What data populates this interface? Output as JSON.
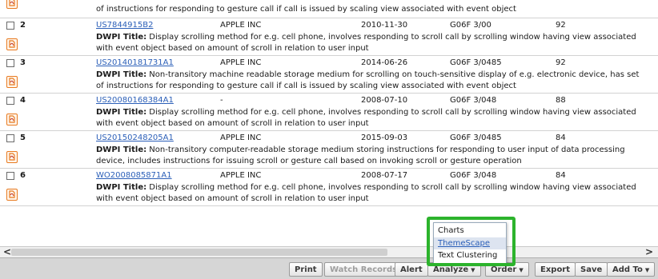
{
  "rows": [
    {
      "num": "",
      "patent_number": "",
      "assignee": "",
      "date": "",
      "ipc": "",
      "score": "",
      "dwpi_label": "",
      "description": "of instructions for responding to gesture call if call is issued by scaling view associated with event object"
    },
    {
      "num": "2",
      "patent_number": "US7844915B2",
      "assignee": "APPLE INC",
      "date": "2010-11-30",
      "ipc": "G06F 3/00",
      "score": "92",
      "dwpi_label": "DWPI Title:",
      "description": "Display scrolling method for e.g. cell phone, involves responding to scroll call by scrolling window having view associated with event object based on amount of scroll in relation to user input"
    },
    {
      "num": "3",
      "patent_number": "US20140181731A1",
      "assignee": "APPLE INC",
      "date": "2014-06-26",
      "ipc": "G06F 3/0485",
      "score": "92",
      "dwpi_label": "DWPI Title:",
      "description": "Non-transitory machine readable storage medium for scrolling on touch-sensitive display of e.g. electronic device, has set of instructions for responding to gesture call if call is issued by scaling view associated with event object"
    },
    {
      "num": "4",
      "patent_number": "US20080168384A1",
      "assignee": "-",
      "date": "2008-07-10",
      "ipc": "G06F 3/048",
      "score": "88",
      "dwpi_label": "DWPI Title:",
      "description": "Display scrolling method for e.g. cell phone, involves responding to scroll call by scrolling window having view associated with event object based on amount of scroll in relation to user input"
    },
    {
      "num": "5",
      "patent_number": "US20150248205A1",
      "assignee": "APPLE INC",
      "date": "2015-09-03",
      "ipc": "G06F 3/0485",
      "score": "84",
      "dwpi_label": "DWPI Title:",
      "description": "Non-transitory computer-readable storage medium storing instructions for responding to user input of data processing device, includes instructions for issuing scroll or gesture call based on invoking scroll or gesture operation"
    },
    {
      "num": "6",
      "patent_number": "WO2008085871A1",
      "assignee": "APPLE INC",
      "date": "2008-07-17",
      "ipc": "G06F 3/048",
      "score": "84",
      "dwpi_label": "DWPI Title:",
      "description": "Display scrolling method for e.g. cell phone, involves responding to scroll call by scrolling window having view associated with event object based on amount of scroll in relation to user input"
    }
  ],
  "analyze_menu": {
    "items": [
      "Charts",
      "ThemeScape",
      "Text Clustering"
    ],
    "highlighted": "ThemeScape"
  },
  "scrollbar": {
    "left_arrow": "<",
    "right_arrow": ">"
  },
  "toolbar": {
    "print": "Print",
    "watch_records": "Watch Records",
    "alert": "Alert",
    "analyze": "Analyze",
    "order": "Order",
    "export": "Export",
    "save": "Save",
    "add_to": "Add To"
  },
  "colors": {
    "highlight_border": "#2cb32c",
    "link": "#2b5fb8",
    "pdf_icon": "#e87a20"
  }
}
